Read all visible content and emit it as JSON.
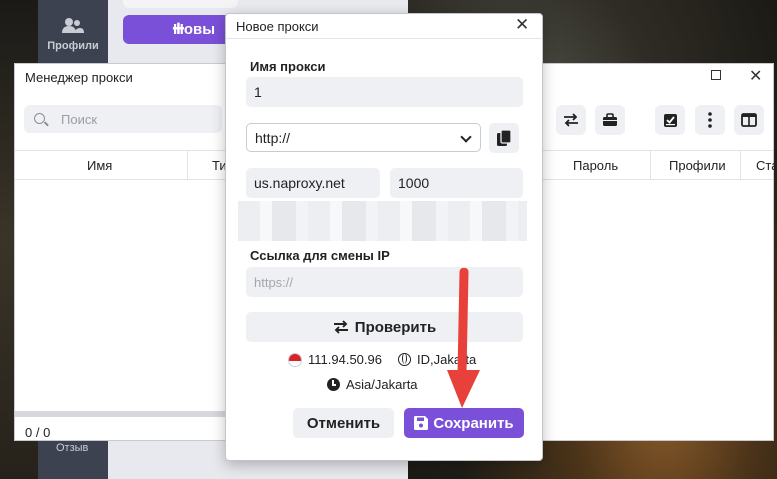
{
  "app": {
    "sidebar_profiles_label": "Профили",
    "sidebar_review_label": "Отзыв",
    "new_button_label": "Новы"
  },
  "manager": {
    "title": "Менеджер прокси",
    "search_placeholder": "Поиск",
    "columns": [
      "Имя",
      "Ти",
      "Пароль",
      "Профили",
      "Ста"
    ],
    "footer_count": "0 / 0"
  },
  "dialog": {
    "title": "Новое прокси",
    "name_label": "Имя прокси",
    "name_value": "1",
    "protocol_value": "http://",
    "host_value": "us.naproxy.net",
    "port_value": "1000",
    "change_ip_label": "Ссылка для смены IP",
    "change_ip_placeholder": "https://",
    "check_button": "Проверить",
    "ip": "111.94.50.96",
    "location": "ID,Jakarta",
    "timezone": "Asia/Jakarta",
    "cancel_button": "Отменить",
    "save_button": "Сохранить"
  },
  "colors": {
    "accent": "#7b50d8",
    "arrow": "#e8403a"
  }
}
